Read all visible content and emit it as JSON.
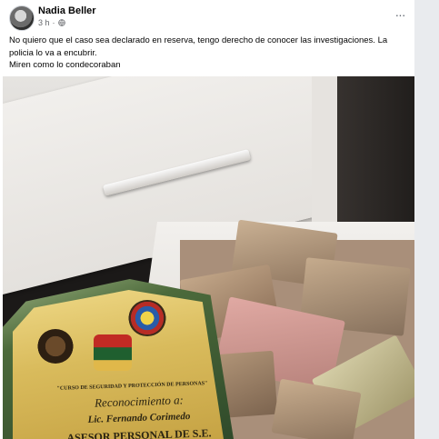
{
  "post": {
    "author": "Nadia Beller",
    "timestamp": "3 h",
    "separator": "·",
    "privacy_icon": "globe-icon",
    "more_icon": "ellipsis-icon",
    "more_label": "···",
    "text_lines": [
      "No quiero que el caso sea declarado en reserva, tengo derecho de conocer las investigaciones. La",
      "policia lo va a encubrir.",
      "Miren como lo condecoraban"
    ]
  },
  "photo": {
    "plaque": {
      "course": "\"CURSO DE SEGURIDAD Y PROTECCIÓN DE PERSONAS\"",
      "recognition": "Reconocimiento a:",
      "name": "Lic. Fernando Corimedo",
      "role": "ASESOR PERSONAL DE S.E."
    }
  },
  "colors": {
    "background": "#e9ebee",
    "card": "#ffffff",
    "text": "#050505",
    "meta": "#65676b"
  }
}
